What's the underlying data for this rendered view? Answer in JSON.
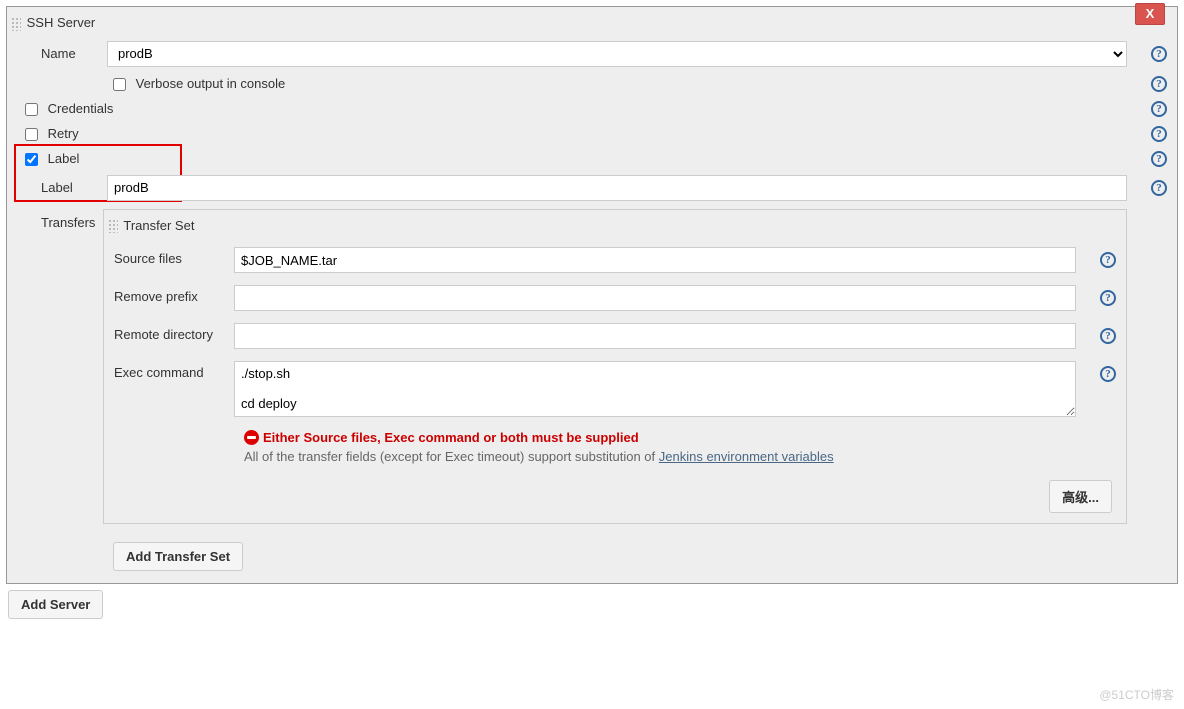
{
  "closeLabel": "X",
  "sshServer": {
    "title": "SSH Server",
    "nameLabel": "Name",
    "nameValue": "prodB",
    "verboseLabel": "Verbose output in console",
    "verboseChecked": false,
    "credentialsLabel": "Credentials",
    "credentialsChecked": false,
    "retryLabel": "Retry",
    "retryChecked": false,
    "labelCheckboxLabel": "Label",
    "labelCheckboxChecked": true,
    "labelFieldLabel": "Label",
    "labelValue": "prodB",
    "transfersLabel": "Transfers"
  },
  "transferSet": {
    "title": "Transfer Set",
    "sourceFilesLabel": "Source files",
    "sourceFilesValue": "$JOB_NAME.tar",
    "removePrefixLabel": "Remove prefix",
    "removePrefixValue": "",
    "remoteDirectoryLabel": "Remote directory",
    "remoteDirectoryValue": "",
    "execCommandLabel": "Exec command",
    "execCommandValue": "./stop.sh\n\ncd deploy",
    "errorText": "Either Source files, Exec command or both must be supplied",
    "noteTextPrefix": "All of the transfer fields (except for Exec timeout) support substitution of ",
    "noteLink": "Jenkins environment variables",
    "advancedButton": "高级...",
    "addTransferSetButton": "Add Transfer Set"
  },
  "addServerButton": "Add Server",
  "watermark": "@51CTO博客"
}
